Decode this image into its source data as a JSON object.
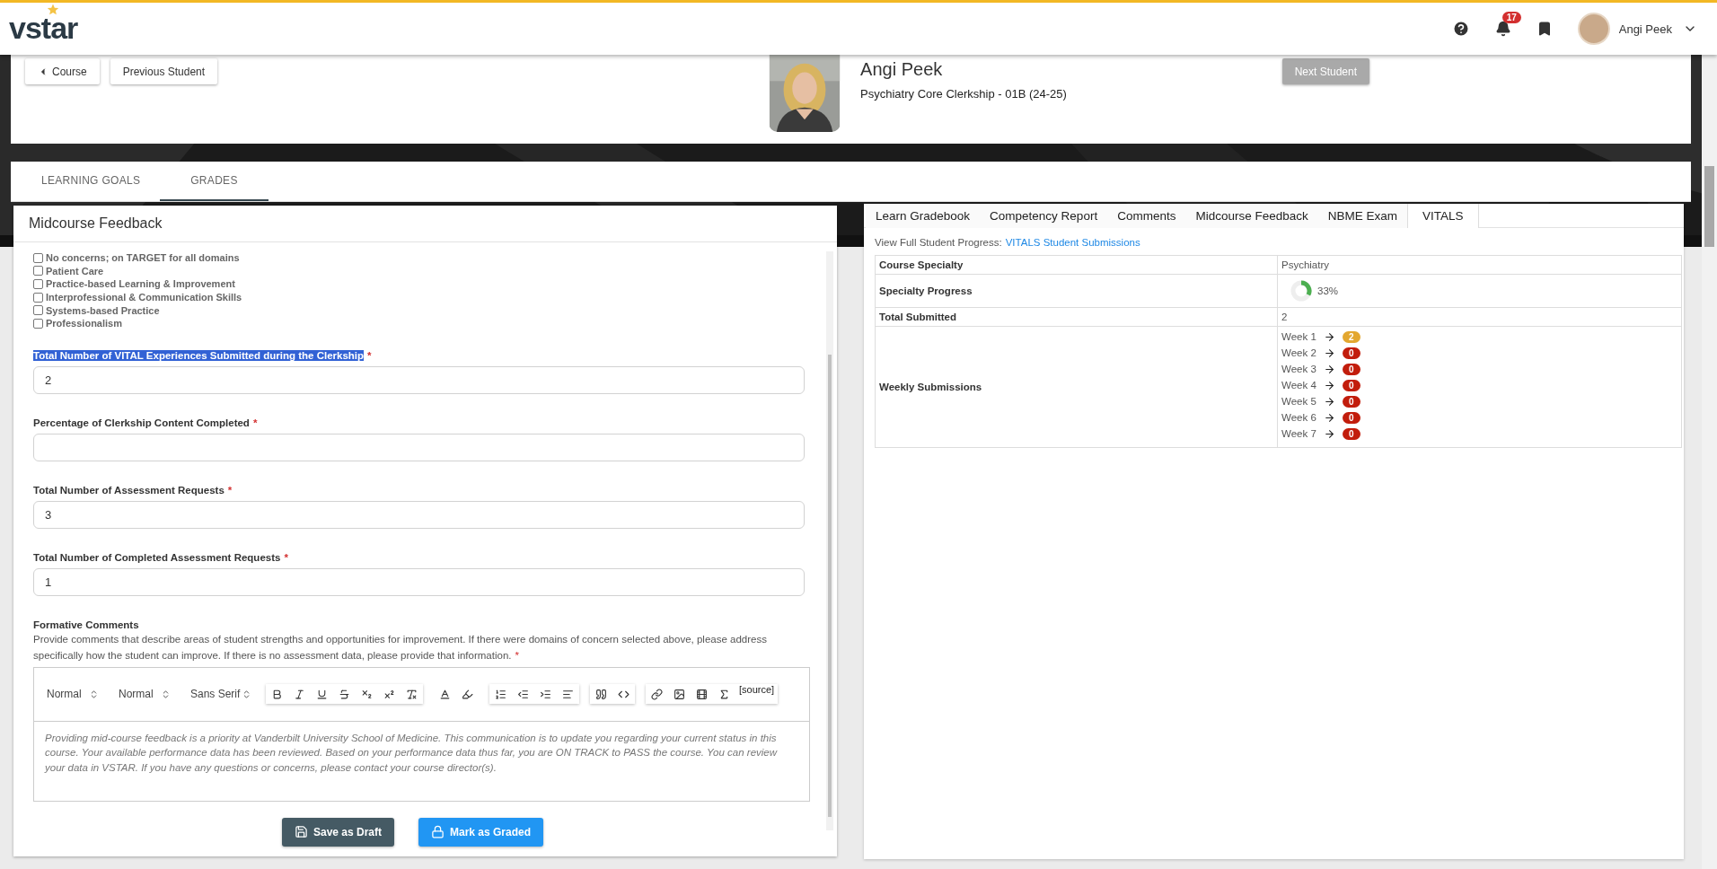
{
  "header": {
    "logo": "vstar",
    "notifications": "17",
    "user": "Angi Peek"
  },
  "student": {
    "back": {
      "label": "Course"
    },
    "previous": {
      "label": "Previous Student"
    },
    "next": {
      "label": "Next Student",
      "disabled": true
    },
    "name": "Angi Peek",
    "course": "Psychiatry Core Clerkship - 01B (24-25)"
  },
  "tabs": [
    {
      "label": "LEARNING GOALS",
      "selected": false
    },
    {
      "label": "GRADES",
      "selected": true
    }
  ],
  "feedback": {
    "title": "Midcourse Feedback",
    "domains": [
      {
        "label": "No concerns; on TARGET for all domains",
        "checked": false
      },
      {
        "label": "Patient Care",
        "checked": false
      },
      {
        "label": "Practice-based Learning & Improvement",
        "checked": false
      },
      {
        "label": "Interprofessional & Communication Skills",
        "checked": false
      },
      {
        "label": "Systems-based Practice",
        "checked": false
      },
      {
        "label": "Professionalism",
        "checked": false
      }
    ],
    "fields": [
      {
        "label": "Total Number of VITAL Experiences Submitted during the Clerkship",
        "required_mark": "*",
        "text_selected": true,
        "value": "2"
      },
      {
        "label": "Percentage of Clerkship Content Completed",
        "required_mark": "*",
        "text_selected": false
      },
      {
        "label": "Total Number of Assessment Requests",
        "required_mark": "*",
        "text_selected": false,
        "value": "3"
      },
      {
        "label": "Total Number of Completed Assessment Requests",
        "required_mark": "*",
        "text_selected": false,
        "value": "1"
      }
    ],
    "comments": {
      "label": "Formative Comments",
      "description": "Provide comments that describe areas of student strengths and opportunities for improvement. If there were domains of concern selected above, please address specifically how the student can improve. If there is no assessment data, please provide that information.",
      "required_mark": "*",
      "selects": [
        "Normal",
        "Normal",
        "Sans Serif"
      ],
      "source": "[source]",
      "placeholder": "Providing mid-course feedback is a priority at Vanderbilt University School of Medicine. This communication is to update you regarding your current status in this course. Your available performance data has been reviewed. Based on your performance data thus far, you are ON TRACK to PASS the course. You can review your data in VSTAR. If you have any questions or concerns, please contact your course director(s)."
    },
    "buttons": [
      {
        "label": "Save as Draft",
        "kind": "draft"
      },
      {
        "label": "Mark as Graded",
        "kind": "graded"
      }
    ]
  },
  "report": {
    "tabs": [
      {
        "label": "Learn Gradebook",
        "selected": false
      },
      {
        "label": "Competency Report",
        "selected": false
      },
      {
        "label": "Comments",
        "selected": false
      },
      {
        "label": "Midcourse Feedback",
        "selected": false
      },
      {
        "label": "NBME Exam",
        "selected": false
      },
      {
        "label": "VITALS",
        "selected": true
      }
    ],
    "intro": "View Full Student Progress:",
    "link": "VITALS Student Submissions",
    "rows": [
      {
        "kind": "text",
        "label": "Course Specialty",
        "value": "Psychiatry"
      },
      {
        "kind": "progress",
        "label": "Specialty Progress",
        "value": "33%"
      },
      {
        "kind": "text",
        "label": "Total Submitted",
        "value": "2"
      },
      {
        "kind": "weeks",
        "label": "Weekly Submissions",
        "weeks": [
          {
            "label": "Week 1",
            "count": "2",
            "color": "#e3a72f"
          },
          {
            "label": "Week 2",
            "count": "0",
            "color": "#c21d0c"
          },
          {
            "label": "Week 3",
            "count": "0",
            "color": "#c21d0c"
          },
          {
            "label": "Week 4",
            "count": "0",
            "color": "#c21d0c"
          },
          {
            "label": "Week 5",
            "count": "0",
            "color": "#c21d0c"
          },
          {
            "label": "Week 6",
            "count": "0",
            "color": "#c21d0c"
          },
          {
            "label": "Week 7",
            "count": "0",
            "color": "#c21d0c"
          }
        ]
      }
    ]
  }
}
